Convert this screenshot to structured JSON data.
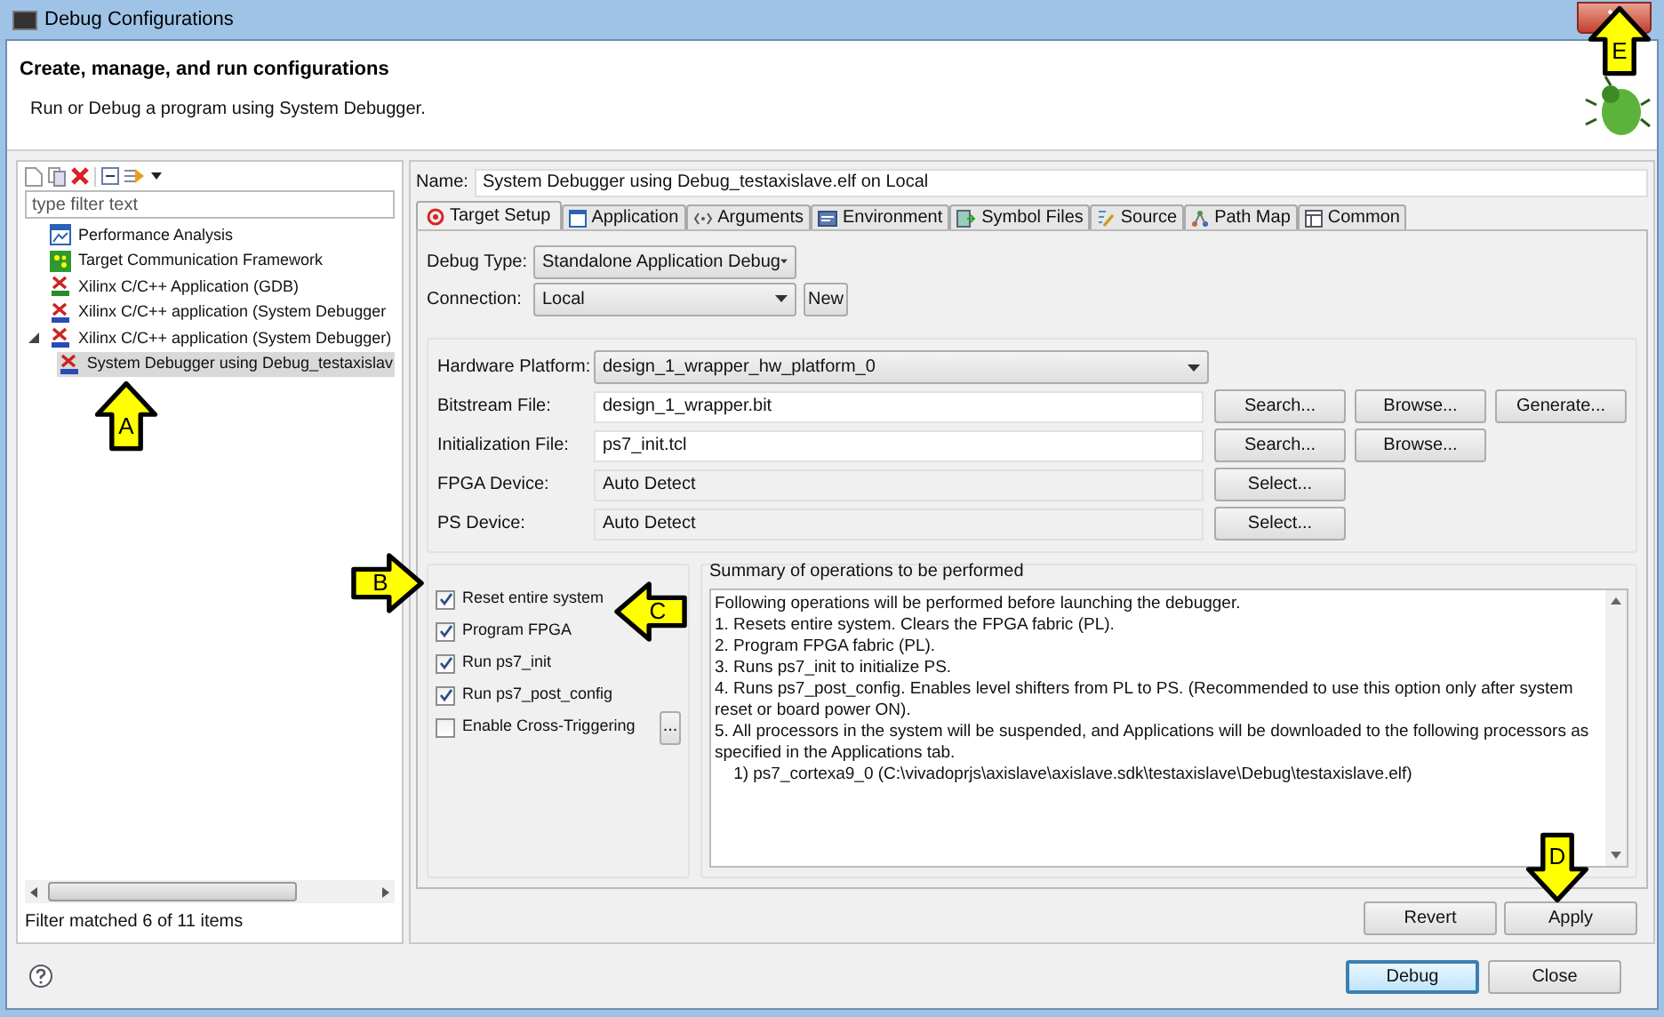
{
  "window": {
    "title": "Debug Configurations"
  },
  "header": {
    "title": "Create, manage, and run configurations",
    "subtitle": "Run or Debug a program using System Debugger."
  },
  "sidebar": {
    "filter": {
      "placeholder": "type filter text"
    },
    "items": [
      {
        "label": "Performance Analysis",
        "kind": "perf",
        "selected": false
      },
      {
        "label": "Target Communication Framework",
        "kind": "tcf",
        "selected": false
      },
      {
        "label": "Xilinx C/C++ Application (GDB)",
        "kind": "gdb",
        "selected": false
      },
      {
        "label": "Xilinx C/C++ application (System Debugger",
        "kind": "sysdbg",
        "selected": false
      },
      {
        "label": "Xilinx C/C++ application (System Debugger)",
        "kind": "sysdbg",
        "selected": false,
        "expanded": true,
        "children": [
          {
            "label": "System Debugger using Debug_testaxislav",
            "kind": "sysdbg",
            "selected": true
          }
        ]
      }
    ],
    "status": "Filter matched 6 of 11 items"
  },
  "name_field": {
    "label": "Name:",
    "value": "System Debugger using Debug_testaxislave.elf on Local"
  },
  "tabs": [
    {
      "label": "Target Setup",
      "kind": "target",
      "selected": true
    },
    {
      "label": "Application",
      "kind": "app",
      "selected": false
    },
    {
      "label": "Arguments",
      "kind": "args",
      "selected": false
    },
    {
      "label": "Environment",
      "kind": "env",
      "selected": false
    },
    {
      "label": "Symbol Files",
      "kind": "sym",
      "selected": false
    },
    {
      "label": "Source",
      "kind": "src",
      "selected": false
    },
    {
      "label": "Path Map",
      "kind": "path",
      "selected": false
    },
    {
      "label": "Common",
      "kind": "common",
      "selected": false
    }
  ],
  "debug_type": {
    "label": "Debug Type:",
    "value": "Standalone Application Debug"
  },
  "connection": {
    "label": "Connection:",
    "value": "Local",
    "button": "New"
  },
  "hardware": [
    {
      "label": "Hardware Platform:",
      "value": "design_1_wrapper_hw_platform_0",
      "kind": "dropdown"
    },
    {
      "label": "Bitstream File:",
      "value": "design_1_wrapper.bit",
      "kind": "text",
      "buttons": [
        "Search...",
        "Browse...",
        "Generate..."
      ]
    },
    {
      "label": "Initialization File:",
      "value": "ps7_init.tcl",
      "kind": "text",
      "buttons": [
        "Search...",
        "Browse..."
      ]
    },
    {
      "label": "FPGA Device:",
      "value": "Auto Detect",
      "kind": "readonly",
      "buttons": [
        "Select..."
      ]
    },
    {
      "label": "PS Device:",
      "value": "Auto Detect",
      "kind": "readonly",
      "buttons": [
        "Select..."
      ]
    }
  ],
  "options": [
    {
      "label": "Reset entire system",
      "checked": true
    },
    {
      "label": "Program FPGA",
      "checked": true
    },
    {
      "label": "Run ps7_init",
      "checked": true
    },
    {
      "label": "Run ps7_post_config",
      "checked": true
    },
    {
      "label": "Enable Cross-Triggering",
      "checked": false,
      "button": "..."
    }
  ],
  "summary": {
    "title": "Summary of operations to be performed",
    "lines": [
      "Following operations will be performed before launching the debugger.",
      "1. Resets entire system. Clears the FPGA fabric (PL).",
      "2. Program FPGA fabric (PL).",
      "3. Runs ps7_init to initialize PS.",
      "4. Runs ps7_post_config. Enables level shifters from PL to PS. (Recommended to use this option only after system reset or board power ON).",
      "5. All processors in the system will be suspended, and Applications will be downloaded to the following processors as specified in the Applications tab.",
      "    1) ps7_cortexa9_0 (C:\\vivadoprjs\\axislave\\axislave.sdk\\testaxislave\\Debug\\testaxislave.elf)"
    ]
  },
  "form_buttons": [
    "Revert",
    "Apply"
  ],
  "dialog_buttons": [
    {
      "label": "Debug",
      "default": true
    },
    {
      "label": "Close",
      "default": false
    }
  ],
  "callouts": [
    {
      "letter": "A",
      "kind": "up"
    },
    {
      "letter": "B",
      "kind": "right"
    },
    {
      "letter": "C",
      "kind": "left"
    },
    {
      "letter": "D",
      "kind": "down"
    },
    {
      "letter": "E",
      "kind": "up"
    }
  ]
}
